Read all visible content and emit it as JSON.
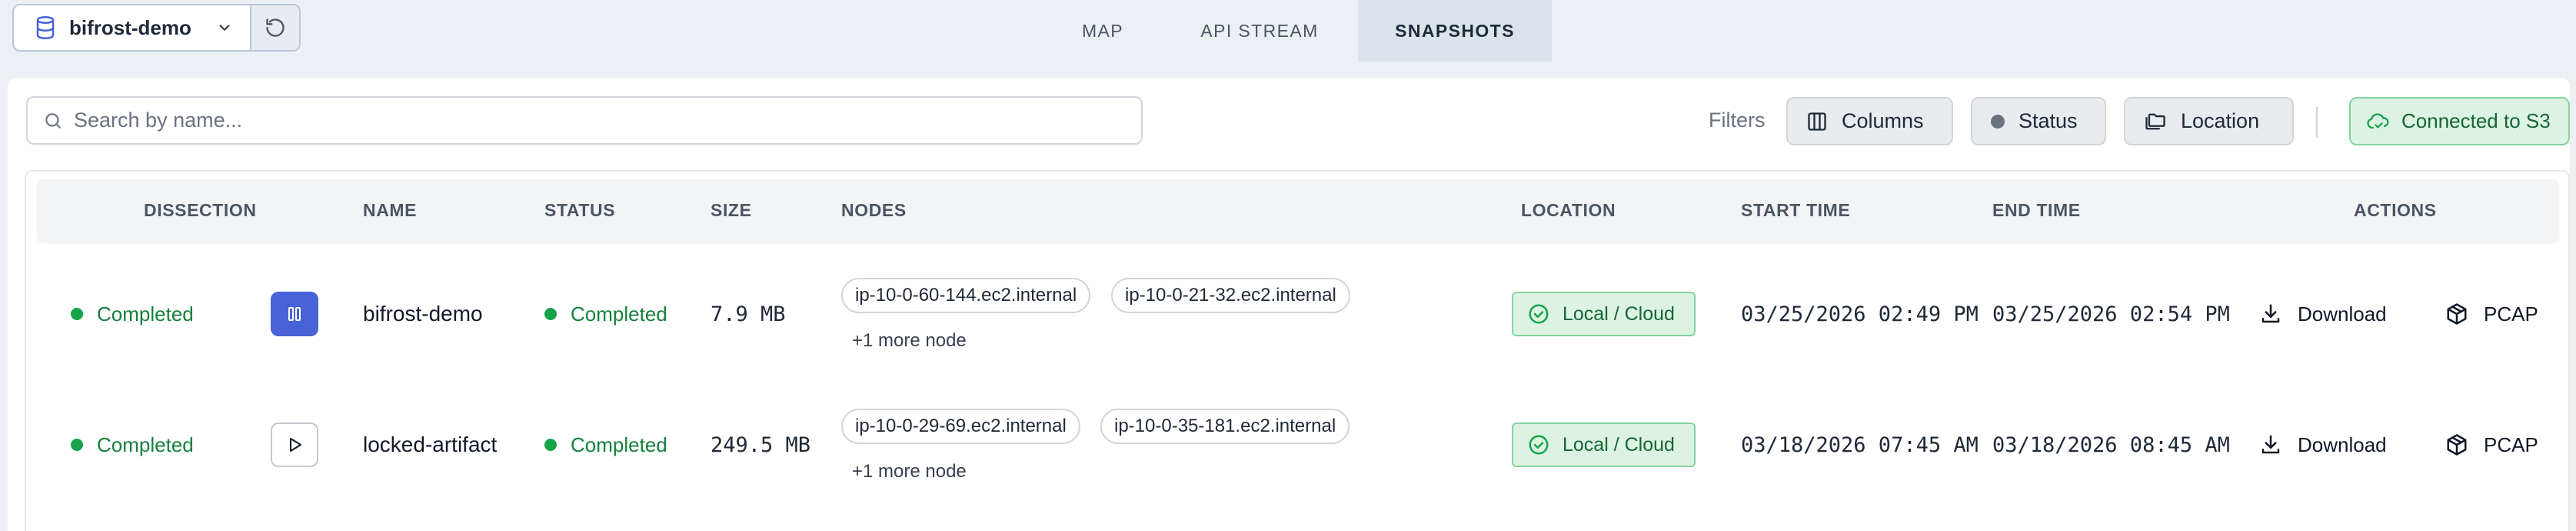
{
  "context": {
    "name": "bifrost-demo",
    "db_icon": "database-icon",
    "refresh_icon": "refresh-icon"
  },
  "tabs": [
    {
      "label": "MAP",
      "active": false
    },
    {
      "label": "API STREAM",
      "active": false
    },
    {
      "label": "SNAPSHOTS",
      "active": true
    }
  ],
  "toolbar": {
    "search_placeholder": "Search by name...",
    "filters_label": "Filters",
    "columns_label": "Columns",
    "status_label": "Status",
    "location_label": "Location",
    "s3_label": "Connected to S3"
  },
  "table": {
    "headers": {
      "dissection": "DISSECTION",
      "name": "NAME",
      "status": "STATUS",
      "size": "SIZE",
      "nodes": "NODES",
      "location": "LOCATION",
      "start": "START TIME",
      "end": "END TIME",
      "actions": "ACTIONS"
    },
    "rows": [
      {
        "dissection_status": "Completed",
        "dissection_control": "pause",
        "name": "bifrost-demo",
        "status": "Completed",
        "size": "7.9 MB",
        "nodes": [
          "ip-10-0-60-144.ec2.internal",
          "ip-10-0-21-32.ec2.internal"
        ],
        "more_nodes": "+1 more node",
        "location": "Local / Cloud",
        "start_time": "03/25/2026 02:49 PM",
        "end_time": "03/25/2026 02:54 PM",
        "download_label": "Download",
        "pcap_label": "PCAP"
      },
      {
        "dissection_status": "Completed",
        "dissection_control": "play",
        "name": "locked-artifact",
        "status": "Completed",
        "size": "249.5 MB",
        "nodes": [
          "ip-10-0-29-69.ec2.internal",
          "ip-10-0-35-181.ec2.internal"
        ],
        "more_nodes": "+1 more node",
        "location": "Local / Cloud",
        "start_time": "03/18/2026 07:45 AM",
        "end_time": "03/18/2026 08:45 AM",
        "download_label": "Download",
        "pcap_label": "PCAP"
      }
    ]
  },
  "colors": {
    "accent": "#4763d6",
    "success": "#16a34a",
    "success_bg": "#dcf3e3",
    "page_bg": "#ecf0f5"
  }
}
